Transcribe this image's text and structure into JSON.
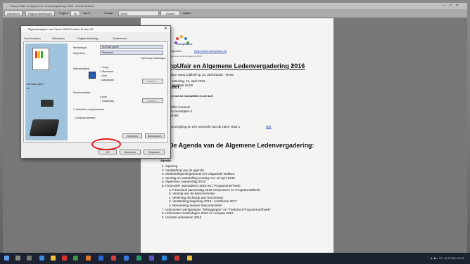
{
  "window": {
    "title": "Compu Ufair en Algemene Ledenvergadering 2016 - Adobe Acrobat",
    "controls": [
      "–",
      "□",
      "✕"
    ]
  },
  "toolbar": {
    "b1": "Afdrukken",
    "b2": "Pagina-instellingen",
    "page_label": "Pagina",
    "page_value": "16",
    "of_label": "van 8",
    "zoom_label": "Schaal",
    "zoom_value": "100%",
    "search_label": "Zoeken",
    "b3": "Lijsten"
  },
  "pageinfo": {
    "left": "CompUfair en Algemene Ledenvergadering 2016",
    "right": "https://www.compusers.nl/print/compufair-algemene-led..."
  },
  "document": {
    "logo_text": "CompUsers",
    "sub": "Gebracht op CompUsers",
    "sub_link": "(http://www.compusers.nl)",
    "breadcrumb": "Home > CompUfair en Algemene Ledenvergadering 2016",
    "heading": "CompUfair en Algemene Ledenvergadering 2016",
    "heading_suffix": "»",
    "posted": "Geplaatst door Hans Dijkhoff op za, 02/04/2016 - 00:00",
    "when_label": "Wanneer:",
    "when_value_1": "zaterdag, 16, april 2016 -",
    "when_value_2": "10:00 tot 16:00",
    "where_intro": "Aan de leden van de CompUfair en de ALV:",
    "loc_1": "Cultureel Willie Centrum",
    "loc_2": "Jan van den Duinstijken 4",
    "loc_3": "3731 GL De Bilt",
    "route_text": "Een routebeschrijving en een overzicht van de zalen vindt u",
    "route_link": "hier",
    "agenda_heading": "De Agenda van de Algemene Ledenvergadering:",
    "agenda_label": "Agenda",
    "items": [
      "1. Opening",
      "2. Vaststelling van de agenda",
      "3. Mededelingen/ingekomen en Uitgaande stukken",
      "4. Verslag en vaststelling verslag ALV 18 april 2015",
      "5. Algemeen Jaarverslag 2015",
      "6. Financiële Jaarstukken 2015 incl. ProgrammaTheek:",
      "a. Financieel jaarverslag 2015 CompUsers en Programmatheek",
      "b. Verslag van de kascommissie",
      "c. Verlening decharge aan het bestuur",
      "d. Vaststelling begroting 2016 / contributie 2017",
      "e. Benoeming nieuwe Kascommissie",
      "7. Uitkomsten werkgroepen \"Beleggingen\" en \"Toekomst ProgrammaTheek\"",
      "8. Uitkomsten Kaderdagen 2015 en voorjaar 2016",
      "9. Voorstel activiteiten 2016"
    ]
  },
  "dialog": {
    "title": "Eigenschappen van Canon MX920 series Printer XE",
    "close": "✕",
    "tabs": [
      "Snel instellen",
      "Afdrukken",
      "Pagina-instelling",
      "Onderhoud"
    ],
    "paper_label": "Normaal papier",
    "paper_size_label": "A4",
    "media_label": "Mediumtype:",
    "media_value": "Normaal papier",
    "papersize_label": "Papierbron:",
    "papersize_value": "Standaard",
    "details_btn": "Details",
    "special_label": "Papiertype-instellingen",
    "quality_label": "Afdrukkwaliteit:",
    "quality_opts": [
      "Hoog",
      "Standaard",
      "Snel",
      "Aangepast"
    ],
    "quality_selected": "Standaard",
    "set_btn": "Instellen...",
    "color_label": "Kleur/Intensiteit:",
    "color_opts": [
      "Auto",
      "Handmatig"
    ],
    "color_selected": "Auto",
    "set_btn2": "Instellen...",
    "grayscale": "Afdrukken in grijswaarden",
    "preview_check": "Afdrukvoorbeeld",
    "defaults_btn": "Standaarden",
    "help_btn": "Help",
    "ok": "OK",
    "cancel": "Annuleren",
    "apply": "Toepassen",
    "extra": "Instructies"
  },
  "taskbar": {
    "tray_text": "^ ▲ ◆ ◐ ⊡ ♪ ◎ ⊟ NLD",
    "clock": "10:37"
  }
}
